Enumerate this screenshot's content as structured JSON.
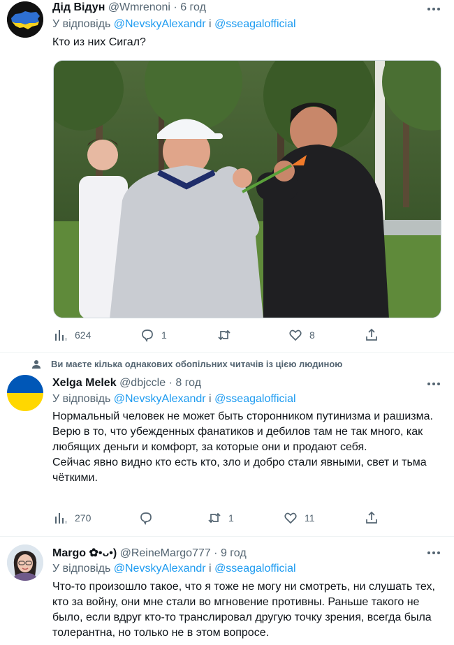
{
  "tweets": [
    {
      "name": "Дід Відун",
      "handle": "@Wmrenoni",
      "time": "6 год",
      "reply_label": "У відповідь",
      "reply_user1": "@NevskyAlexandr",
      "reply_and": "і",
      "reply_user2": "@sseagalofficial",
      "text": [
        "Кто из них Сигал?"
      ],
      "views": "624",
      "replies": "1",
      "retweets": "",
      "likes": "8",
      "has_image": true
    },
    {
      "social_context": "Ви маєте кілька однакових обопільних читачів із цією людиною",
      "name": "Xelga Melek",
      "handle": "@dbjccle",
      "time": "8 год",
      "reply_label": "У відповідь",
      "reply_user1": "@NevskyAlexandr",
      "reply_and": "і",
      "reply_user2": "@sseagalofficial",
      "text": [
        "Нормальный человек не может быть сторонником путинизма и рашизма. Верю в то, что убежденных фанатиков и дебилов там не так много, как любящих деньги и комфорт, за которые они и продают себя.",
        "Сейчас явно видно кто есть кто, зло и добро стали явными, свет и тьма чёткими."
      ],
      "views": "270",
      "replies": "",
      "retweets": "1",
      "likes": "11"
    },
    {
      "name": "Margo ✿•ᴗ•)",
      "handle": "@ReineMargo777",
      "time": "9 год",
      "reply_label": "У відповідь",
      "reply_user1": "@NevskyAlexandr",
      "reply_and": "і",
      "reply_user2": "@sseagalofficial",
      "text": [
        "Что-то произошло такое, что я тоже не могу ни смотреть, ни слушать тех, кто за войну, они мне стали во мгновение противны. Раньше такого не было, если вдруг кто-то транслировал другую точку зрения, всегда была толерантна, но только не в этом вопросе."
      ]
    }
  ],
  "icons": {
    "views": "bar-chart-icon",
    "reply": "speech-bubble-icon",
    "retweet": "retweet-icon",
    "like": "heart-icon",
    "share": "share-icon",
    "more": "more-dots-icon"
  },
  "colors": {
    "link": "#1d9bf0",
    "secondary": "#536471",
    "ukraine_blue": "#0057b7",
    "ukraine_yellow": "#ffd700"
  }
}
